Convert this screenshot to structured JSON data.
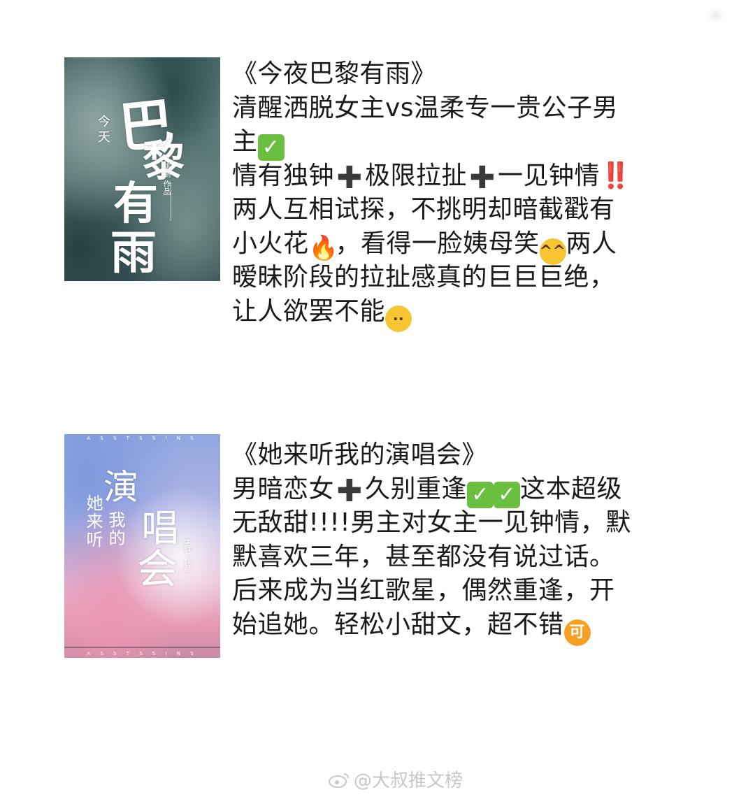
{
  "books": [
    {
      "cover_chars": {
        "big1": "巴",
        "big2": "黎",
        "big3": "有",
        "big4": "雨",
        "small1": "今",
        "small2": "天",
        "author": "桃蓟 作品"
      },
      "lines": [
        "《今夜巴黎有雨》",
        "清醒洒脱女主vs温柔专一贵公子男",
        "主",
        "情有独钟",
        "极限拉扯",
        "一见钟情‼️",
        "两人互相试探，不挑明却暗截戳有",
        "小火花",
        "，看得一脸姨母笑",
        "两人",
        "暧昧阶段的拉扯感真的巨巨巨绝，",
        "让人欲罢不能"
      ]
    },
    {
      "cover_chars": {
        "big1": "演",
        "big2": "唱",
        "big3": "会",
        "small1": "她来听",
        "small2": "我的",
        "author": "王钰 作品",
        "ribbon": "A S S T S S I N S"
      },
      "lines": [
        "《她来听我的演唱会》",
        "男暗恋女",
        "久别重逢",
        "这本超级",
        "无敌甜!!!!男主对女主一见钟情，默",
        "默喜欢三年，甚至都没有说过话。",
        "后来成为当红歌星，偶然重逢，开",
        "始追她。轻松小甜文，超不错"
      ]
    }
  ],
  "emoji": {
    "check": "✓",
    "plus": "✚",
    "fire": "🔥",
    "grin": "^^",
    "plead": "··",
    "ke": "可"
  },
  "footer": {
    "text": "@大叔推文榜"
  }
}
